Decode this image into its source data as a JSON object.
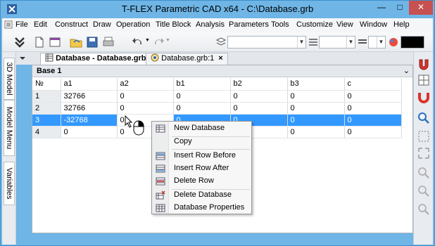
{
  "window": {
    "title": "T-FLEX Parametric CAD x64 - C:\\Database.grb"
  },
  "menu": [
    "File",
    "Edit",
    "Construct",
    "Draw",
    "Operation",
    "Title Block",
    "Analysis",
    "Parameters",
    "Tools",
    "Customize",
    "View",
    "Window",
    "Help"
  ],
  "left_tabs": [
    "3D Model",
    "Model Menu",
    "Variables"
  ],
  "doc_tabs": [
    {
      "label": "Database - Database.grb",
      "close": "×",
      "active": true
    },
    {
      "label": "Database.grb:1",
      "close": "×",
      "active": false
    }
  ],
  "database": {
    "name": "Base 1",
    "columns": [
      "№",
      "a1",
      "a2",
      "b1",
      "b2",
      "b3",
      "c"
    ],
    "rows": [
      [
        "1",
        "32766",
        "0",
        "0",
        "0",
        "0",
        "0"
      ],
      [
        "2",
        "32766",
        "0",
        "0",
        "0",
        "0",
        "0"
      ],
      [
        "3",
        "-32768",
        "0",
        "0",
        "0",
        "0",
        "0"
      ],
      [
        "4",
        "0",
        "0",
        "0",
        "0",
        "0",
        "0"
      ]
    ],
    "selected_row": 3
  },
  "context_menu": {
    "items": [
      "New Database",
      "Copy",
      "Insert Row Before",
      "Insert Row After",
      "Delete Row",
      "Delete Database",
      "Database Properties"
    ]
  },
  "colors": {
    "titlebar": "#6fb5e6",
    "selection": "#3399ff",
    "close_button": "#c75050"
  }
}
